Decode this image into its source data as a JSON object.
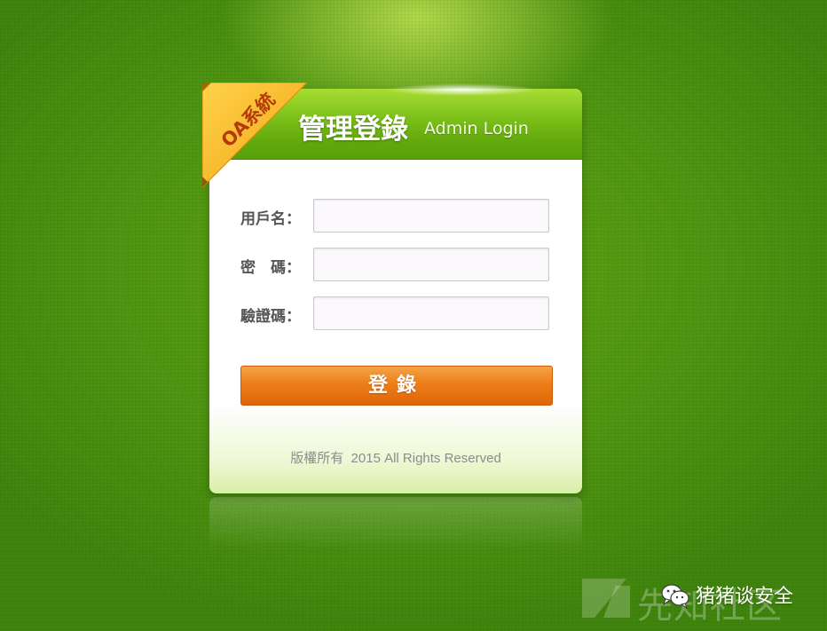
{
  "ribbon": {
    "label": "OA系統"
  },
  "header": {
    "title_cn": "管理登錄",
    "title_en": "Admin Login"
  },
  "form": {
    "username_label": "用戶名：",
    "password_label": "密　碼：",
    "captcha_label": "驗證碼：",
    "username_value": "",
    "password_value": "",
    "captcha_value": ""
  },
  "login_button": {
    "label": "登錄"
  },
  "footer": {
    "copyright": "版權所有  2015 All Rights Reserved"
  },
  "watermark": {
    "site_text": "先知社区",
    "account_name": "猪猪谈安全"
  },
  "colors": {
    "background": "#4f9610",
    "header_green": "#7ec11b",
    "button_orange": "#ec7d18",
    "ribbon_yellow": "#f5b51f"
  },
  "icons": [
    "ribbon-corner",
    "wechat-icon",
    "xianzhi-logo-icon"
  ]
}
